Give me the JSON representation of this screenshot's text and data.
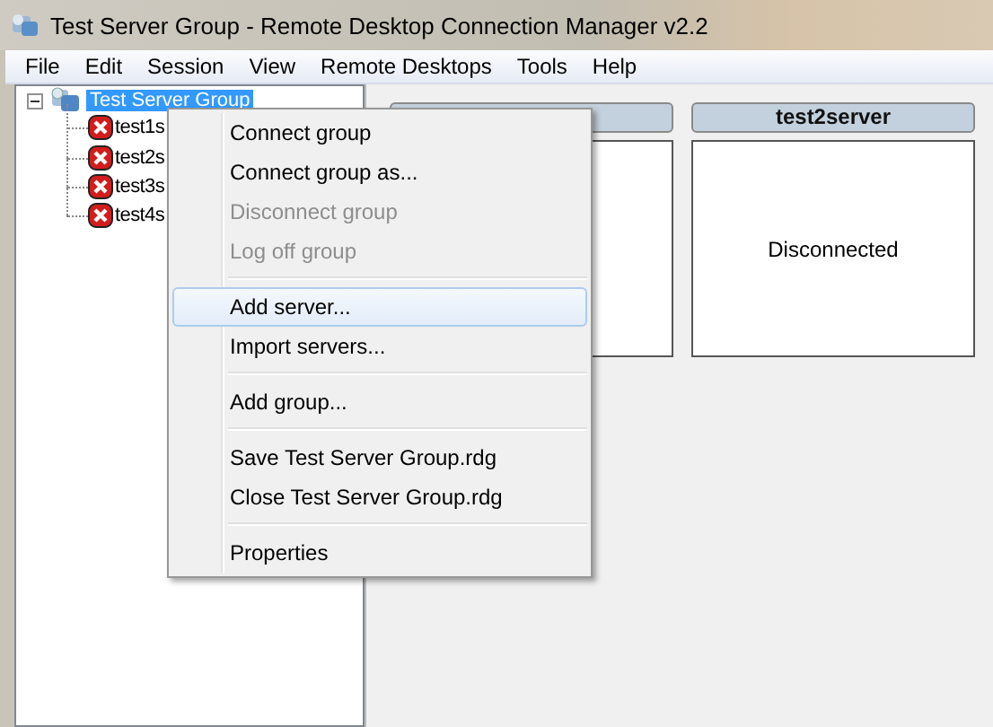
{
  "window": {
    "title": "Test Server Group - Remote Desktop Connection Manager v2.2"
  },
  "menu_bar": [
    "File",
    "Edit",
    "Session",
    "View",
    "Remote Desktops",
    "Tools",
    "Help"
  ],
  "tree": {
    "label": "Test Server Group",
    "selected": true,
    "expanded": true,
    "children": [
      {
        "label": "test1s",
        "connected": false
      },
      {
        "label": "test2s",
        "connected": false
      },
      {
        "label": "test3s",
        "connected": false
      },
      {
        "label": "test4s",
        "connected": false
      }
    ]
  },
  "tiles": [
    {
      "kind": "tile"
    },
    {
      "kind": "tile",
      "name": "test2server",
      "status": "Disconnected"
    }
  ],
  "context_menu": [
    {
      "kind": "item",
      "label": "Connect group",
      "disabled": false,
      "selected": false
    },
    {
      "kind": "item",
      "label": "Connect group as...",
      "disabled": false,
      "selected": false
    },
    {
      "kind": "item",
      "label": "Disconnect group",
      "disabled": true,
      "selected": false
    },
    {
      "kind": "item",
      "label": "Log off group",
      "disabled": true,
      "selected": false
    },
    {
      "kind": "separator"
    },
    {
      "kind": "item",
      "label": "Add server...",
      "disabled": false,
      "selected": true
    },
    {
      "kind": "item",
      "label": "Import servers...",
      "disabled": false,
      "selected": false
    },
    {
      "kind": "separator"
    },
    {
      "kind": "item",
      "label": "Add group...",
      "disabled": false,
      "selected": false
    },
    {
      "kind": "separator"
    },
    {
      "kind": "item",
      "label": "Save Test Server Group.rdg",
      "disabled": false,
      "selected": false
    },
    {
      "kind": "item",
      "label": "Close Test Server Group.rdg",
      "disabled": false,
      "selected": false
    },
    {
      "kind": "separator"
    },
    {
      "kind": "item",
      "label": "Properties",
      "disabled": false,
      "selected": false
    }
  ]
}
